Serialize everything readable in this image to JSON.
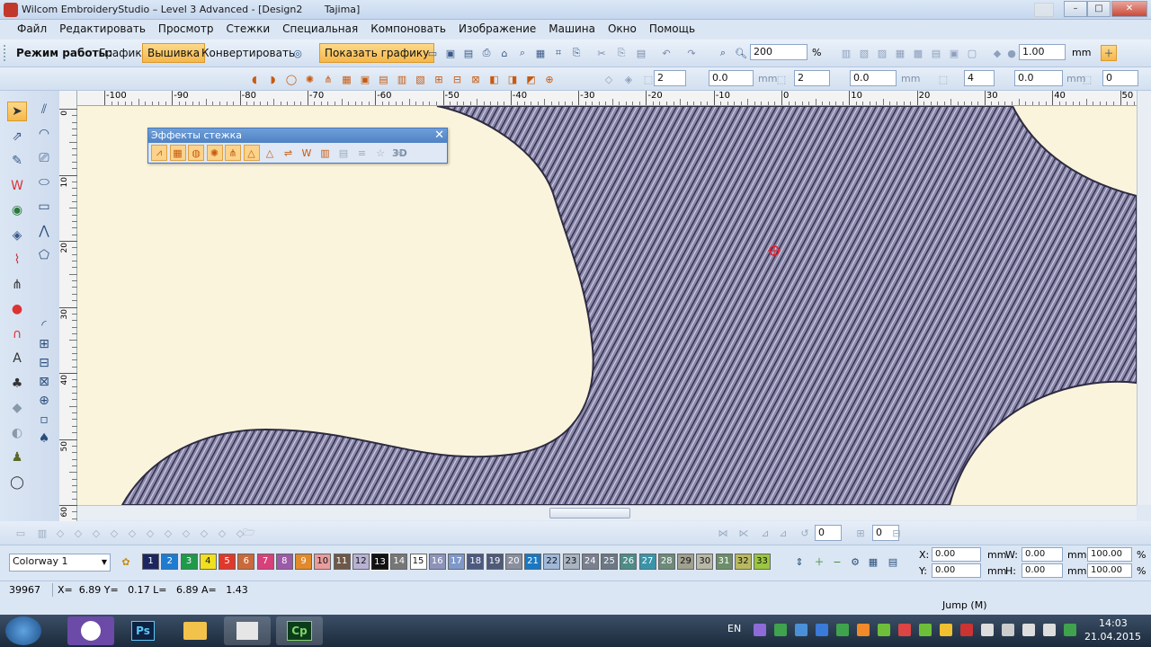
{
  "window": {
    "title": "Wilcom EmbroideryStudio – Level 3 Advanced - [Design2       Tajima]",
    "min": "–",
    "max": "□",
    "close": "✕"
  },
  "menu": [
    "Файл",
    "Редактировать",
    "Просмотр",
    "Стежки",
    "Специальная",
    "Компоновать",
    "Изображение",
    "Машина",
    "Окно",
    "Помощь"
  ],
  "toolbar": {
    "mode_label": "Режим работы:",
    "mode_graphics": "Графика",
    "mode_embroidery": "Вышивка",
    "mode_convert": "Конвертировать",
    "show_graphics": "Показать графику",
    "zoom_value": "200",
    "zoom_unit": "%",
    "scale_value": "1.00",
    "scale_unit": "mm"
  },
  "toolbar2": {
    "field_a": "2",
    "field_b": "0.0",
    "field_b_unit": "mm",
    "field_c": "2",
    "field_d": "0.0",
    "field_d_unit": "mm",
    "field_e": "4",
    "field_f": "0.0",
    "field_f_unit": "mm",
    "field_g": "0"
  },
  "ruler": {
    "h_ticks": [
      "-100",
      "-90",
      "-80",
      "-70",
      "-60",
      "-50",
      "-40",
      "-30",
      "-20",
      "-10",
      "0",
      "10",
      "20",
      "30",
      "40",
      "50"
    ],
    "v_ticks": [
      "0",
      "10",
      "20",
      "30",
      "40",
      "50",
      "60"
    ]
  },
  "palette": {
    "title": "Эффекты стежка",
    "close": "✕",
    "label_3d": "3D"
  },
  "tb3": {
    "field_a": "0",
    "field_b": "0"
  },
  "colorway": {
    "selected": "Colorway 1",
    "swatches": [
      {
        "n": "1",
        "c": "#1c2660"
      },
      {
        "n": "2",
        "c": "#1f7bd0"
      },
      {
        "n": "3",
        "c": "#1f9a4a"
      },
      {
        "n": "4",
        "c": "#f0e020"
      },
      {
        "n": "5",
        "c": "#e0392b"
      },
      {
        "n": "6",
        "c": "#c96a3b"
      },
      {
        "n": "7",
        "c": "#d8407a"
      },
      {
        "n": "8",
        "c": "#9c5aa8"
      },
      {
        "n": "9",
        "c": "#e28a2a"
      },
      {
        "n": "10",
        "c": "#e89c9c"
      },
      {
        "n": "11",
        "c": "#6e5848"
      },
      {
        "n": "12",
        "c": "#b8b2d2"
      },
      {
        "n": "13",
        "c": "#111111"
      },
      {
        "n": "14",
        "c": "#777777"
      },
      {
        "n": "15",
        "c": "#ffffff"
      },
      {
        "n": "16",
        "c": "#8d93b8"
      },
      {
        "n": "17",
        "c": "#7e99c9"
      },
      {
        "n": "18",
        "c": "#4d5a80"
      },
      {
        "n": "19",
        "c": "#4f5a78"
      },
      {
        "n": "20",
        "c": "#8a8f9e"
      },
      {
        "n": "21",
        "c": "#1a78c2"
      },
      {
        "n": "22",
        "c": "#a0b8d8"
      },
      {
        "n": "23",
        "c": "#aab3c0"
      },
      {
        "n": "24",
        "c": "#7a8090"
      },
      {
        "n": "25",
        "c": "#6d7785"
      },
      {
        "n": "26",
        "c": "#4d8c88"
      },
      {
        "n": "27",
        "c": "#3a94a8"
      },
      {
        "n": "28",
        "c": "#6d8a7a"
      },
      {
        "n": "29",
        "c": "#a0a090"
      },
      {
        "n": "30",
        "c": "#b8b8a8"
      },
      {
        "n": "31",
        "c": "#6d8e6a"
      },
      {
        "n": "32",
        "c": "#b8b860"
      },
      {
        "n": "33",
        "c": "#9ac640"
      }
    ]
  },
  "props": {
    "x_label": "X:",
    "x_value": "0.00",
    "x_unit": "mm",
    "y_label": "Y:",
    "y_value": "0.00",
    "y_unit": "mm",
    "w_label": "W:",
    "w_value": "0.00",
    "w_unit": "mm",
    "w_pct": "100.00",
    "w_pct_unit": "%",
    "h_label": "H:",
    "h_value": "0.00",
    "h_unit": "mm",
    "h_pct": "100.00",
    "h_pct_unit": "%"
  },
  "status": {
    "stitch_count": "39967",
    "coords": "X=  6.89 Y=   0.17 L=   6.89 A=   1.43",
    "stitch_type": "Jump (M)"
  },
  "taskbar": {
    "lang": "EN",
    "time": "14:03",
    "date": "21.04.2015",
    "apps": [
      "Ps",
      "Cp"
    ]
  }
}
